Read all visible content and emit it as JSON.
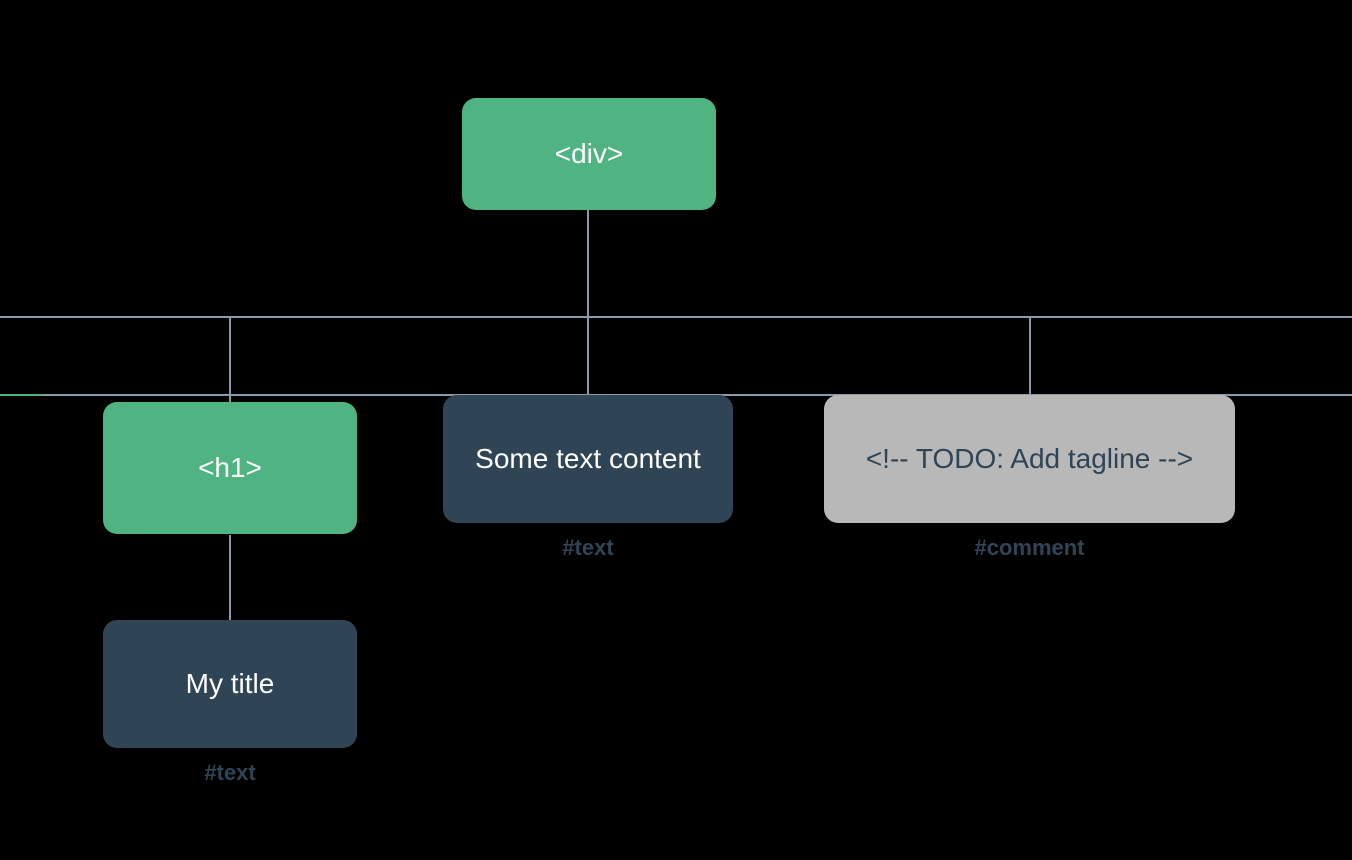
{
  "colors": {
    "element_node": "#4FB382",
    "text_node": "#2F4455",
    "comment_node": "#B8B8B8",
    "line": "#8A9AA6",
    "background": "#000000"
  },
  "tree": {
    "root": {
      "type": "element",
      "label": "<div>",
      "children": [
        {
          "type": "element",
          "label": "<h1>",
          "children": [
            {
              "type": "text",
              "label": "My title",
              "caption": "#text"
            }
          ]
        },
        {
          "type": "text",
          "label": "Some text content",
          "caption": "#text"
        },
        {
          "type": "comment",
          "label": "<!-- TODO: Add tagline  -->",
          "caption": "#comment"
        }
      ]
    }
  },
  "nodes": {
    "root": {
      "label": "<div>"
    },
    "h1": {
      "label": "<h1>"
    },
    "some": {
      "label": "Some text content"
    },
    "comment": {
      "label": "<!-- TODO: Add tagline  -->"
    },
    "title": {
      "label": "My title"
    }
  },
  "captions": {
    "some": "#text",
    "comment": "#comment",
    "title": "#text"
  },
  "layout_notes": "DOM tree diagram: a <div> root with three children — an <h1> element node (green), a text node 'Some text content' (navy), and a comment node (gray). The <h1> has one text-node child 'My title'. Captions #text / #comment label node types."
}
